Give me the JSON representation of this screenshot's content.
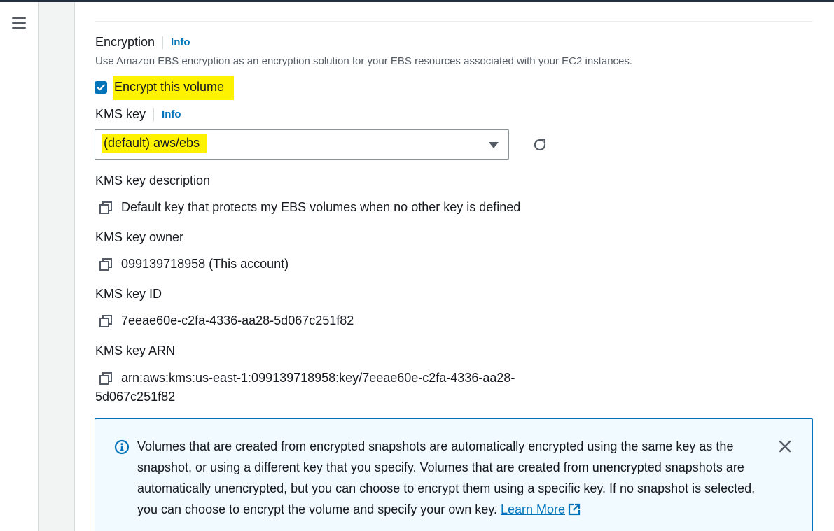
{
  "encryption": {
    "label": "Encryption",
    "info_label": "Info",
    "description": "Use Amazon EBS encryption as an encryption solution for your EBS resources associated with your EC2 instances.",
    "checkbox_label": "Encrypt this volume",
    "checkbox_checked": true
  },
  "kms_key": {
    "label": "KMS key",
    "info_label": "Info",
    "selected_value": "(default) aws/ebs"
  },
  "details": {
    "description_label": "KMS key description",
    "description_value": "Default key that protects my EBS volumes when no other key is defined",
    "owner_label": "KMS key owner",
    "owner_value": "099139718958 (This account)",
    "id_label": "KMS key ID",
    "id_value": "7eeae60e-c2fa-4336-aa28-5d067c251f82",
    "arn_label": "KMS key ARN",
    "arn_value_line1": "arn:aws:kms:us-east-1:099139718958:key/7eeae60e-c2fa-4336-aa28-",
    "arn_value_line2": "5d067c251f82"
  },
  "alert": {
    "text": "Volumes that are created from encrypted snapshots are automatically encrypted using the same key as the snapshot, or using a different key that you specify. Volumes that are created from unencrypted snapshots are automatically unencrypted, but you can choose to encrypt them using a specific key. If no snapshot is selected, you can choose to encrypt the volume and specify your own key.",
    "link_label": "Learn More"
  },
  "colors": {
    "accent": "#0073bb",
    "highlight": "#fff200",
    "alert_background": "#f1faff"
  },
  "icons": {
    "menu": "hamburger-menu-icon",
    "refresh": "refresh-icon",
    "copy": "copy-icon",
    "info": "info-circle-icon",
    "close": "close-icon",
    "external": "external-link-icon"
  }
}
